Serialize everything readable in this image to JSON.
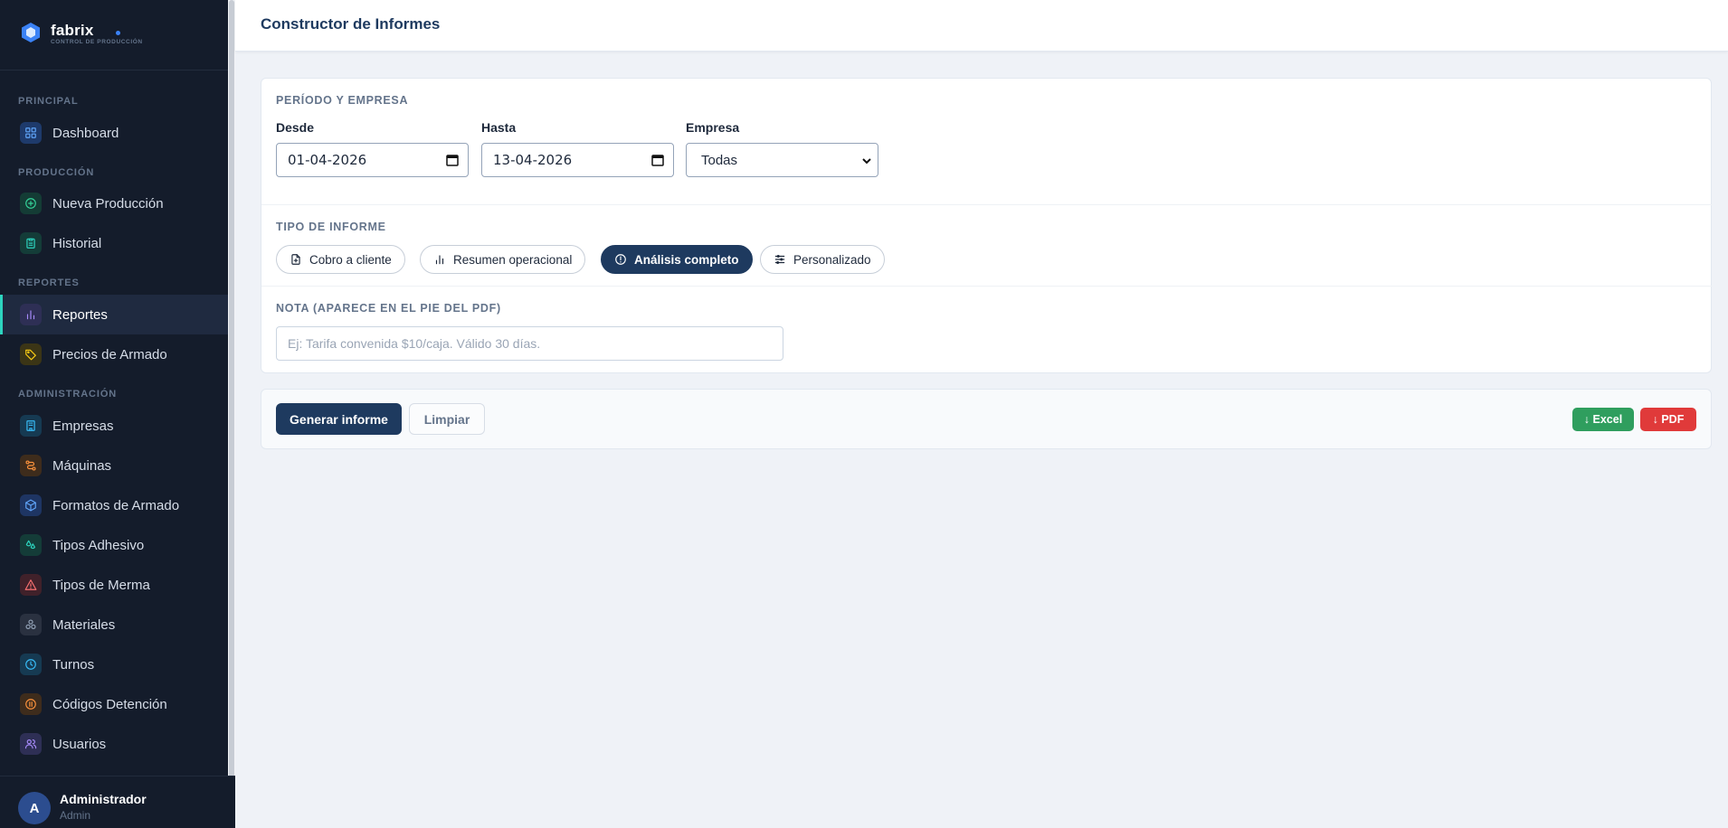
{
  "brand": {
    "name": "fabrix",
    "subtitle": "CONTROL DE PRODUCCIÓN",
    "accent": "#3b82f6"
  },
  "sidebar": {
    "sections": [
      {
        "label": "PRINCIPAL"
      },
      {
        "label": "PRODUCCIÓN"
      },
      {
        "label": "REPORTES"
      },
      {
        "label": "ADMINISTRACIÓN"
      }
    ],
    "items": [
      {
        "label": "Dashboard",
        "icon": "grid-icon"
      },
      {
        "label": "Nueva Producción",
        "icon": "plus-circle-icon"
      },
      {
        "label": "Historial",
        "icon": "clipboard-icon"
      },
      {
        "label": "Reportes",
        "icon": "bar-chart-icon",
        "active": true
      },
      {
        "label": "Precios de Armado",
        "icon": "tag-icon"
      },
      {
        "label": "Empresas",
        "icon": "building-icon"
      },
      {
        "label": "Máquinas",
        "icon": "route-icon"
      },
      {
        "label": "Formatos de Armado",
        "icon": "box-icon"
      },
      {
        "label": "Tipos Adhesivo",
        "icon": "droplets-icon"
      },
      {
        "label": "Tipos de Merma",
        "icon": "warning-icon"
      },
      {
        "label": "Materiales",
        "icon": "layers-icon"
      },
      {
        "label": "Turnos",
        "icon": "clock-icon"
      },
      {
        "label": "Códigos Detención",
        "icon": "stop-circle-icon"
      },
      {
        "label": "Usuarios",
        "icon": "users-icon"
      }
    ]
  },
  "user": {
    "initial": "A",
    "name": "Administrador",
    "role": "Admin"
  },
  "header": {
    "title": "Constructor de Informes"
  },
  "period": {
    "section_title": "PERÍODO Y EMPRESA",
    "from_label": "Desde",
    "from_value": "01-04-2026",
    "to_label": "Hasta",
    "to_value": "13-04-2026",
    "company_label": "Empresa",
    "company_value": "Todas"
  },
  "report_type": {
    "section_title": "TIPO DE INFORME",
    "options": [
      {
        "label": "Cobro a cliente",
        "icon": "file-plus-icon"
      },
      {
        "label": "Resumen operacional",
        "icon": "bar-chart-icon"
      },
      {
        "label": "Análisis completo",
        "icon": "alert-circle-icon",
        "selected": true
      },
      {
        "label": "Personalizado",
        "icon": "sliders-icon"
      }
    ]
  },
  "note": {
    "section_title": "NOTA (APARECE EN EL PIE DEL PDF)",
    "placeholder": "Ej: Tarifa convenida $10/caja. Válido 30 días.",
    "value": ""
  },
  "actions": {
    "generate_label": "Generar informe",
    "clear_label": "Limpiar",
    "excel_label": "↓ Excel",
    "pdf_label": "↓ PDF"
  },
  "colors": {
    "primary": "#1e3a5f",
    "sidebar_bg": "#141c2b",
    "active_indicator": "#2dd4bf",
    "excel": "#2f9e5e",
    "pdf": "#e03a3a"
  }
}
